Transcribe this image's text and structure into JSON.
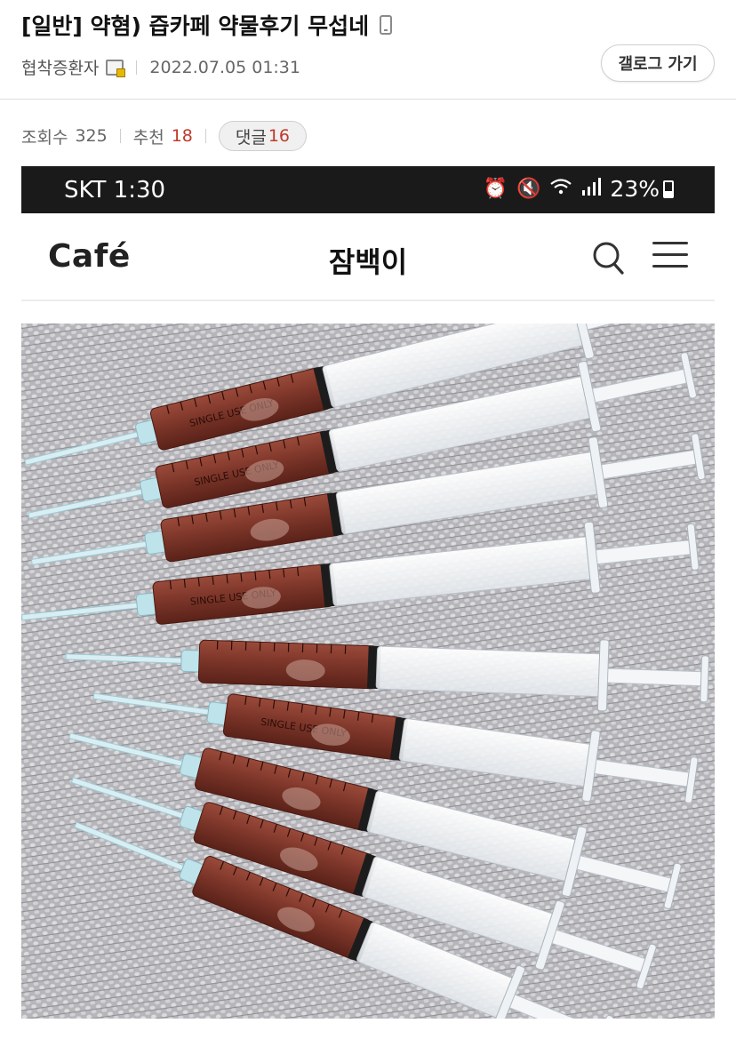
{
  "post": {
    "title": "[일반] 약혐) 즙카페 약물후기 무섭네",
    "author": "협착증환자",
    "date": "2022.07.05 01:31",
    "gallery_button": "갤로그 가기",
    "views_label": "조회수",
    "views": "325",
    "recommend_label": "추천",
    "recommend": "18",
    "comments_label": "댓글",
    "comments": "16"
  },
  "screenshot": {
    "status_bar": {
      "carrier_time": "SKT 1:30",
      "battery": "23%"
    },
    "cafe_header": {
      "logo": "Café",
      "title": "잠백이"
    },
    "icons": [
      "alarm-icon",
      "mute-icon",
      "wifi-icon",
      "signal-icon",
      "battery-icon",
      "search-icon",
      "menu-icon"
    ]
  },
  "syringes": [
    {
      "label": "SINGLE USE ONLY"
    },
    {
      "label": "SINGLE USE ONLY"
    },
    {
      "label": ""
    },
    {
      "label": "SINGLE USE ONLY"
    },
    {
      "label": ""
    },
    {
      "label": "SINGLE USE ONLY"
    },
    {
      "label": ""
    },
    {
      "label": ""
    },
    {
      "label": ""
    }
  ],
  "colors": {
    "accent_red": "#c0392b",
    "liquid": "#7a3428",
    "background_fabric": "#b9b9bd"
  }
}
